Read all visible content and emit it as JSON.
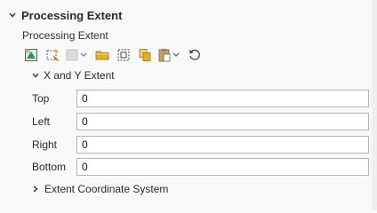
{
  "section": {
    "title": "Processing Extent"
  },
  "parameter": {
    "label": "Processing Extent"
  },
  "toolbar": {
    "icons": [
      "layer-extent-icon",
      "draw-extent-icon",
      "color-swatch-dropdown-icon",
      "browse-folder-icon",
      "select-extent-icon",
      "copy-extent-icon",
      "paste-dropdown-icon",
      "reset-icon"
    ]
  },
  "xy_extent": {
    "title": "X and Y Extent",
    "fields": [
      {
        "label": "Top",
        "value": "0"
      },
      {
        "label": "Left",
        "value": "0"
      },
      {
        "label": "Right",
        "value": "0"
      },
      {
        "label": "Bottom",
        "value": "0"
      }
    ]
  },
  "coordinate_system": {
    "title": "Extent Coordinate System"
  },
  "colors": {
    "accent_yellow": "#e8b021",
    "accent_green": "#3a8f5a",
    "border": "#b4b4b4"
  }
}
